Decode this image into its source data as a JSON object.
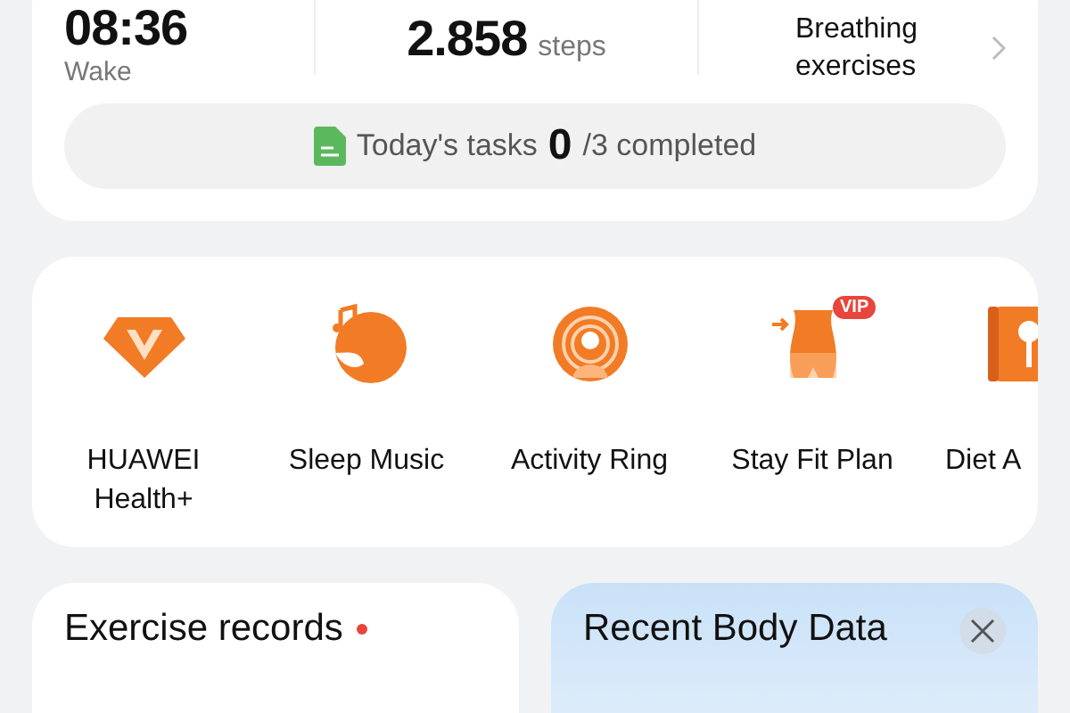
{
  "summary": {
    "sleep": {
      "value": "08:36",
      "label": "Wake"
    },
    "steps": {
      "value": "2.858",
      "unit": "steps"
    },
    "link": {
      "label": "Breathing exercises"
    }
  },
  "tasks": {
    "label": "Today's tasks",
    "done": "0",
    "total": "/3 completed"
  },
  "shortcuts": [
    {
      "kind": "diamond",
      "label": "HUAWEI Health+"
    },
    {
      "kind": "moon",
      "label": "Sleep Music"
    },
    {
      "kind": "ring",
      "label": "Activity Ring"
    },
    {
      "kind": "waist",
      "label": "Stay Fit Plan",
      "badge": "VIP"
    },
    {
      "kind": "book",
      "label": "Diet A"
    }
  ],
  "cards": [
    {
      "kind": "plain",
      "title": "Exercise records",
      "unread": true,
      "closable": false
    },
    {
      "kind": "tinted",
      "title": "Recent Body Data",
      "unread": false,
      "closable": true
    }
  ]
}
